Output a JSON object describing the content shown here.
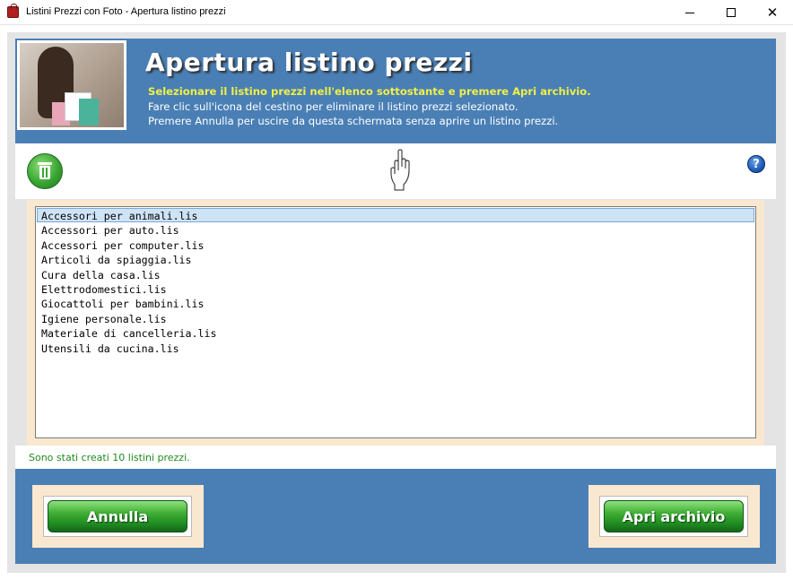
{
  "window": {
    "title": "Listini Prezzi con Foto - Apertura listino prezzi",
    "minimize": "—",
    "maximize": "☐",
    "close": "✕"
  },
  "header": {
    "title": "Apertura listino prezzi",
    "subtitle": "Selezionare il listino prezzi nell'elenco sottostante e premere Apri archivio.",
    "line1": "Fare clic sull'icona del cestino per eliminare il listino prezzi selezionato.",
    "line2": "Premere Annulla per uscire da questa schermata senza aprire un listino prezzi."
  },
  "toolbar": {
    "delete_icon": "trash-icon",
    "pointer_icon": "pointing-hand-icon",
    "help_icon": "help-icon",
    "help_glyph": "?"
  },
  "files": [
    "Accessori per animali.lis",
    "Accessori per auto.lis",
    "Accessori per computer.lis",
    "Articoli da spiaggia.lis",
    "Cura della casa.lis",
    "Elettrodomestici.lis",
    "Giocattoli per bambini.lis",
    "Igiene personale.lis",
    "Materiale di cancelleria.lis",
    "Utensili da cucina.lis"
  ],
  "selected_index": 0,
  "status": "Sono stati creati 10 listini prezzi.",
  "buttons": {
    "cancel": "Annulla",
    "open": "Apri archivio"
  },
  "colors": {
    "header_blue": "#4a7fb5",
    "panel_beige": "#f9e8cf",
    "subtitle_yellow": "#f0f046",
    "status_green": "#1f8a1f",
    "button_green": "#2f9e2c"
  }
}
